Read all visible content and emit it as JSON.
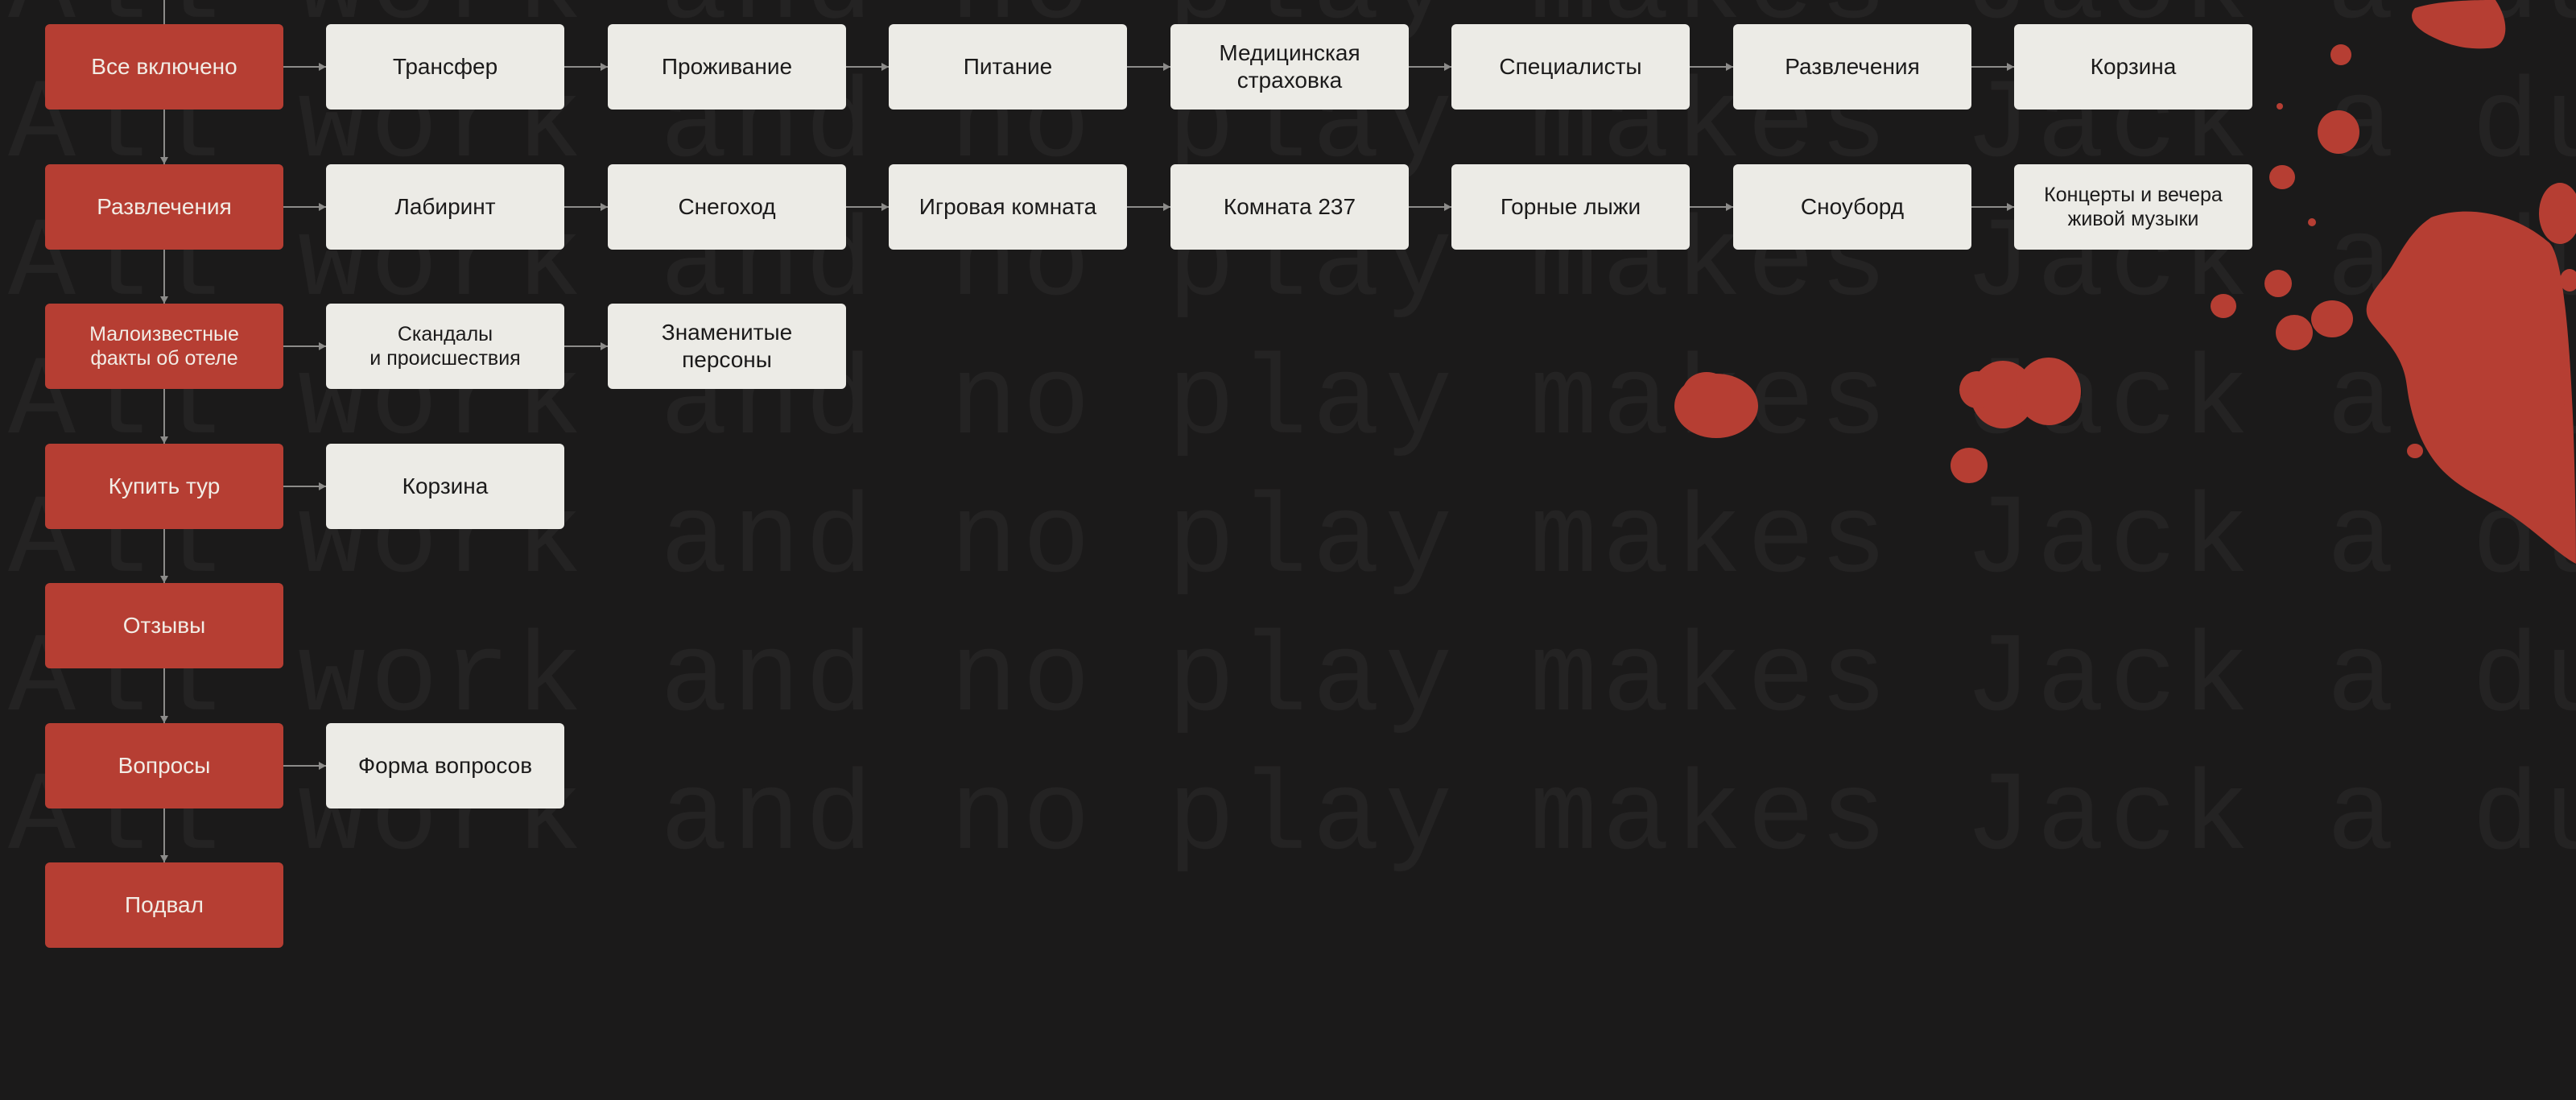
{
  "background_text": "All work and no play makes Jack a dull boy",
  "colors": {
    "background": "#1b1a1a",
    "primary_node": "#b63e33",
    "secondary_node": "#ecebe6",
    "connector": "#8c8b89",
    "blood": "#b63e33"
  },
  "diagram": {
    "main_nodes": [
      {
        "label": "Все включено"
      },
      {
        "label": "Развлечения"
      },
      {
        "label": "Малоизвестные\nфакты об отеле"
      },
      {
        "label": "Купить тур"
      },
      {
        "label": "Отзывы"
      },
      {
        "label": "Вопросы"
      },
      {
        "label": "Подвал"
      }
    ],
    "rows": [
      {
        "children": [
          {
            "label": "Трансфер"
          },
          {
            "label": "Проживание"
          },
          {
            "label": "Питание"
          },
          {
            "label": "Медицинская\nстраховка"
          },
          {
            "label": "Специалисты"
          },
          {
            "label": "Развлечения"
          },
          {
            "label": "Корзина"
          }
        ]
      },
      {
        "children": [
          {
            "label": "Лабиринт"
          },
          {
            "label": "Снегоход"
          },
          {
            "label": "Игровая комната"
          },
          {
            "label": "Комната 237"
          },
          {
            "label": "Горные лыжи"
          },
          {
            "label": "Сноуборд"
          },
          {
            "label": "Концерты и вечера\nживой музыки"
          }
        ]
      },
      {
        "children": [
          {
            "label": "Скандалы\nи происшествия"
          },
          {
            "label": "Знаменитые\nперсоны"
          }
        ]
      },
      {
        "children": [
          {
            "label": "Корзина"
          }
        ]
      },
      {
        "children": []
      },
      {
        "children": [
          {
            "label": "Форма вопросов"
          }
        ]
      },
      {
        "children": []
      }
    ]
  }
}
